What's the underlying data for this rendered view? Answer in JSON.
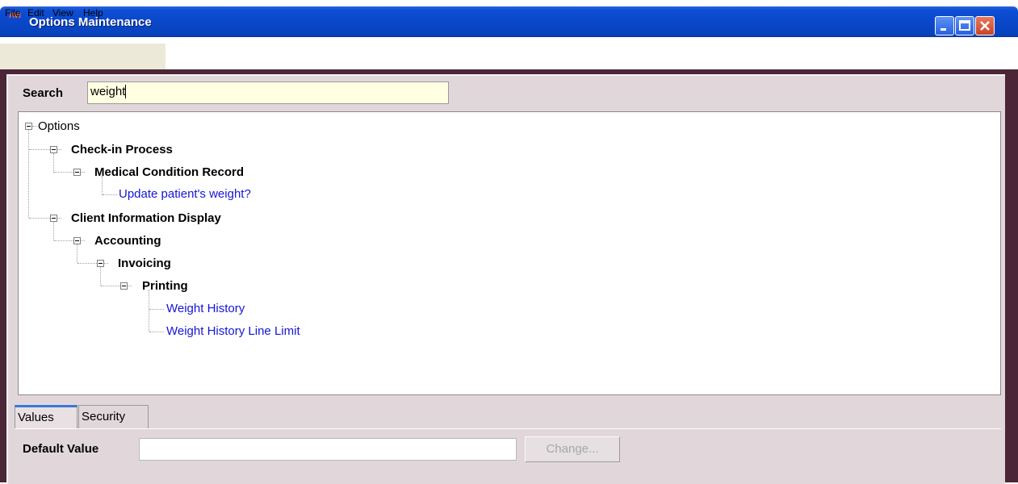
{
  "window": {
    "icon_text": "AVI",
    "title": "Options Maintenance"
  },
  "menu": {
    "items": [
      "File",
      "Edit",
      "View",
      "Help"
    ]
  },
  "search": {
    "label": "Search",
    "value": "weight"
  },
  "tree": {
    "root": "Options",
    "nodes": [
      {
        "label": "Check-in Process",
        "type": "category"
      },
      {
        "label": "Medical Condition Record",
        "type": "category"
      },
      {
        "label": "Update patient's weight?",
        "type": "option"
      },
      {
        "label": "Client Information Display",
        "type": "category"
      },
      {
        "label": "Accounting",
        "type": "category"
      },
      {
        "label": "Invoicing",
        "type": "category"
      },
      {
        "label": "Printing",
        "type": "category"
      },
      {
        "label": "Weight History",
        "type": "option"
      },
      {
        "label": "Weight History Line Limit",
        "type": "option"
      }
    ]
  },
  "tabs": [
    "Values",
    "Security"
  ],
  "values_tab": {
    "default_value_label": "Default Value",
    "default_value": "",
    "change_button": "Change..."
  },
  "colors": {
    "titlebar": "#0a47c8",
    "panel": "#e1d7db",
    "frame": "#4a2636",
    "option_link": "#1515d8",
    "search_bg": "#ffffe2"
  }
}
